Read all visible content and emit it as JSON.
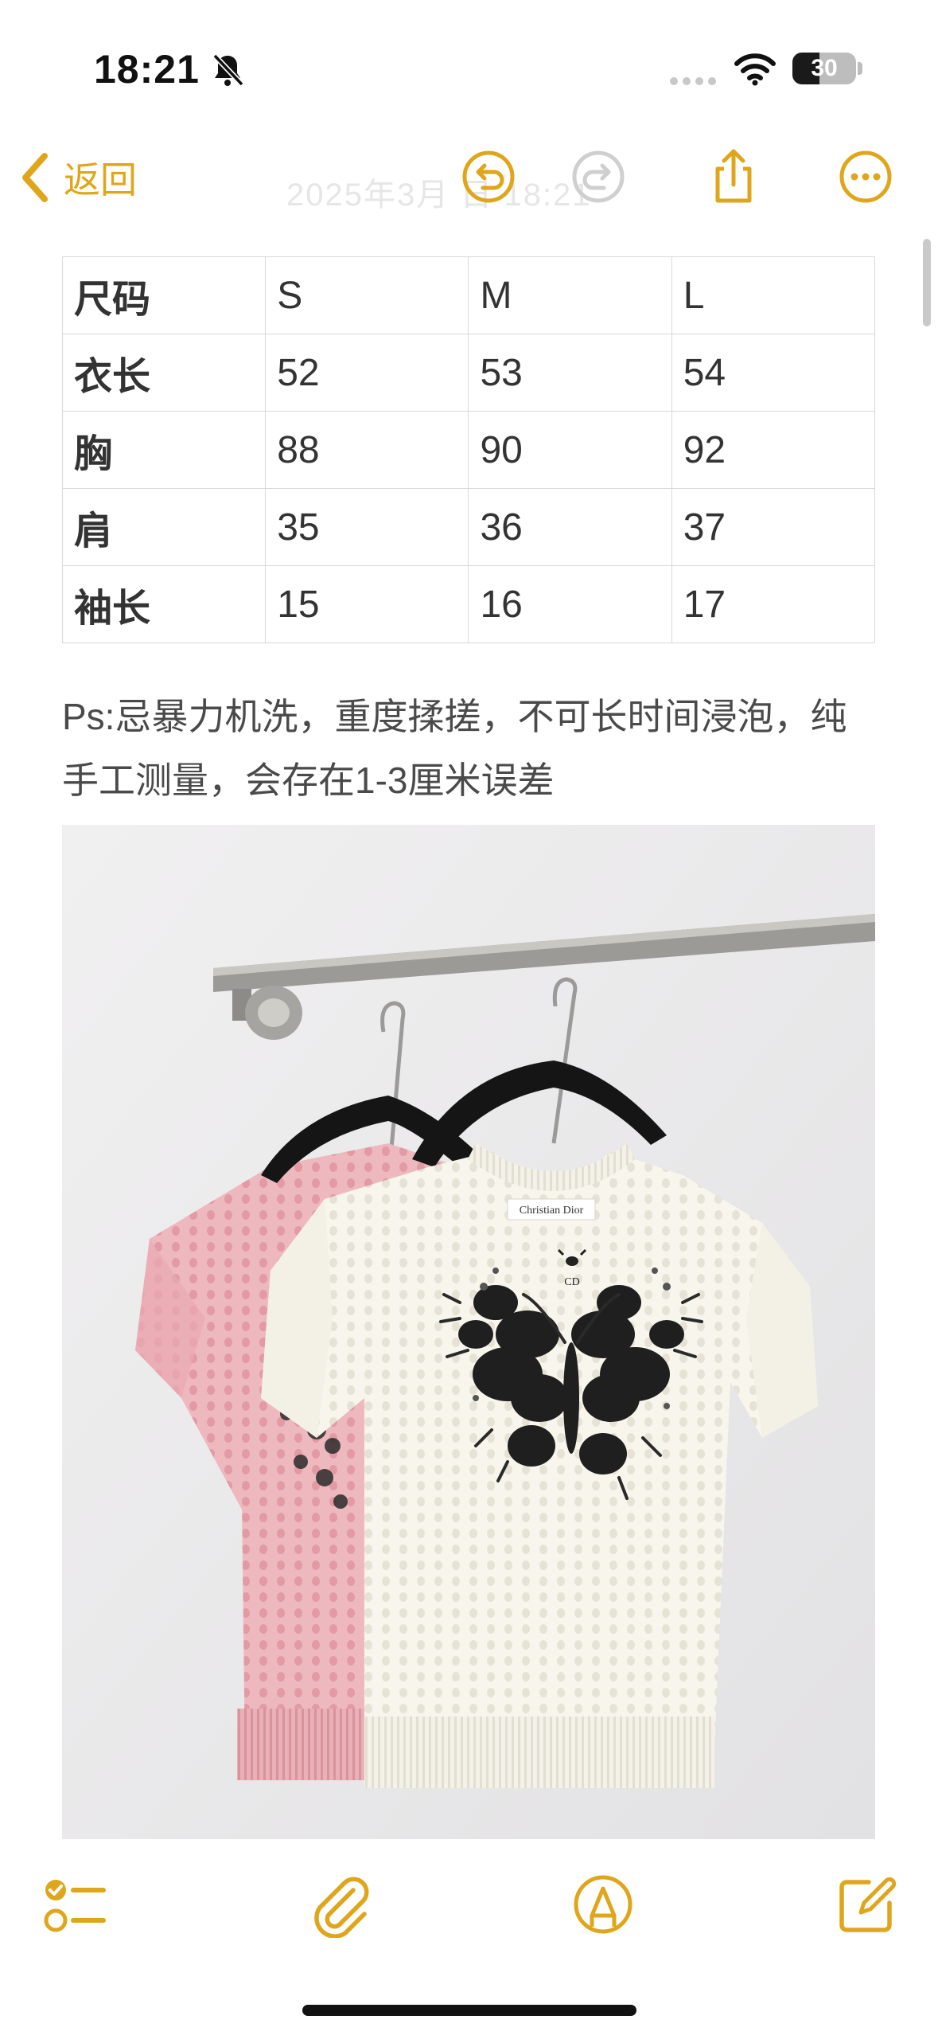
{
  "status_bar": {
    "time": "18:21",
    "battery": "30",
    "icons": [
      "bell-slash-icon",
      "cellular-signal-icon",
      "wifi-icon",
      "battery-icon"
    ]
  },
  "nav": {
    "back_label": "返回",
    "title": "2025年3月  日  18:21",
    "accent_color": "#e0a61b",
    "icons": [
      "undo-icon",
      "redo-icon",
      "share-icon",
      "more-icon"
    ]
  },
  "size_table": {
    "header": [
      "尺码",
      "S",
      "M",
      "L"
    ],
    "rows": [
      [
        "衣长",
        "52",
        "53",
        "54"
      ],
      [
        "胸",
        "88",
        "90",
        "92"
      ],
      [
        "肩",
        "35",
        "36",
        "37"
      ],
      [
        "袖长",
        "15",
        "16",
        "17"
      ]
    ]
  },
  "note": "Ps:忌暴力机洗，重度揉搓，不可长时间浸泡，纯手工测量，会存在1-3厘米误差",
  "photo": {
    "label_text": "Christian Dior",
    "logo_text": "CD"
  },
  "toolbar": {
    "icons": [
      "checklist-icon",
      "paperclip-icon",
      "markup-pen-icon",
      "compose-icon"
    ]
  }
}
